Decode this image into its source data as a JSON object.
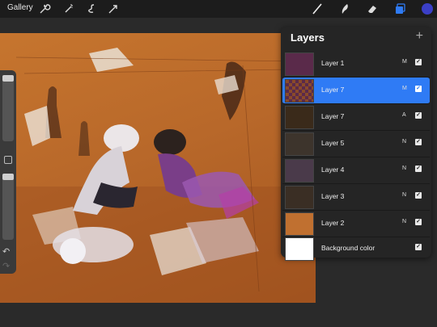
{
  "topbar": {
    "gallery_label": "Gallery",
    "tools_left": [
      "wrench-icon",
      "magic-wand-icon",
      "adjustments-icon",
      "selection-arrow-icon"
    ],
    "tools_right": [
      "brush-icon",
      "smudge-icon",
      "eraser-icon",
      "layers-icon",
      "color-icon"
    ],
    "active_color": "#3b3fc6",
    "layers_icon_color": "#2f7bf5"
  },
  "layers": {
    "title": "Layers",
    "add_label": "+",
    "rows": [
      {
        "name": "Layer 1",
        "blend": "M",
        "checked": true,
        "selected": false,
        "thumb": "#5a2a4a"
      },
      {
        "name": "Layer 7",
        "blend": "M",
        "checked": true,
        "selected": true,
        "thumb": "checker"
      },
      {
        "name": "Layer 7",
        "blend": "A",
        "checked": true,
        "selected": false,
        "thumb": "#3a2a1a"
      },
      {
        "name": "Layer 5",
        "blend": "N",
        "checked": true,
        "selected": false,
        "thumb": "#3d342c"
      },
      {
        "name": "Layer 4",
        "blend": "N",
        "checked": true,
        "selected": false,
        "thumb": "#4a3a4a"
      },
      {
        "name": "Layer 3",
        "blend": "N",
        "checked": true,
        "selected": false,
        "thumb": "#3a2e24"
      },
      {
        "name": "Layer 2",
        "blend": "N",
        "checked": true,
        "selected": false,
        "thumb": "#c07030"
      },
      {
        "name": "Background color",
        "blend": "",
        "checked": true,
        "selected": false,
        "thumb": "#ffffff"
      }
    ]
  },
  "sidebar": {
    "undo_label": "↶",
    "redo_label": "↷"
  }
}
